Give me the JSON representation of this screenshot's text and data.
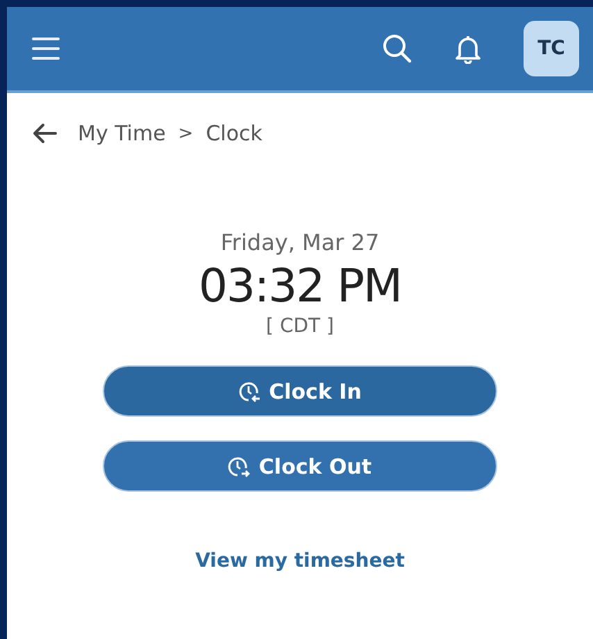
{
  "header": {
    "avatar": "TC"
  },
  "breadcrumb": {
    "items": [
      "My Time",
      "Clock"
    ],
    "separator": ">"
  },
  "clock": {
    "date": "Friday, Mar 27",
    "time": "03:32 PM",
    "timezone": "[ CDT ]"
  },
  "buttons": [
    {
      "label": "Clock In",
      "kind": "in"
    },
    {
      "label": "Clock Out",
      "kind": "out"
    }
  ],
  "link": "View my timesheet"
}
